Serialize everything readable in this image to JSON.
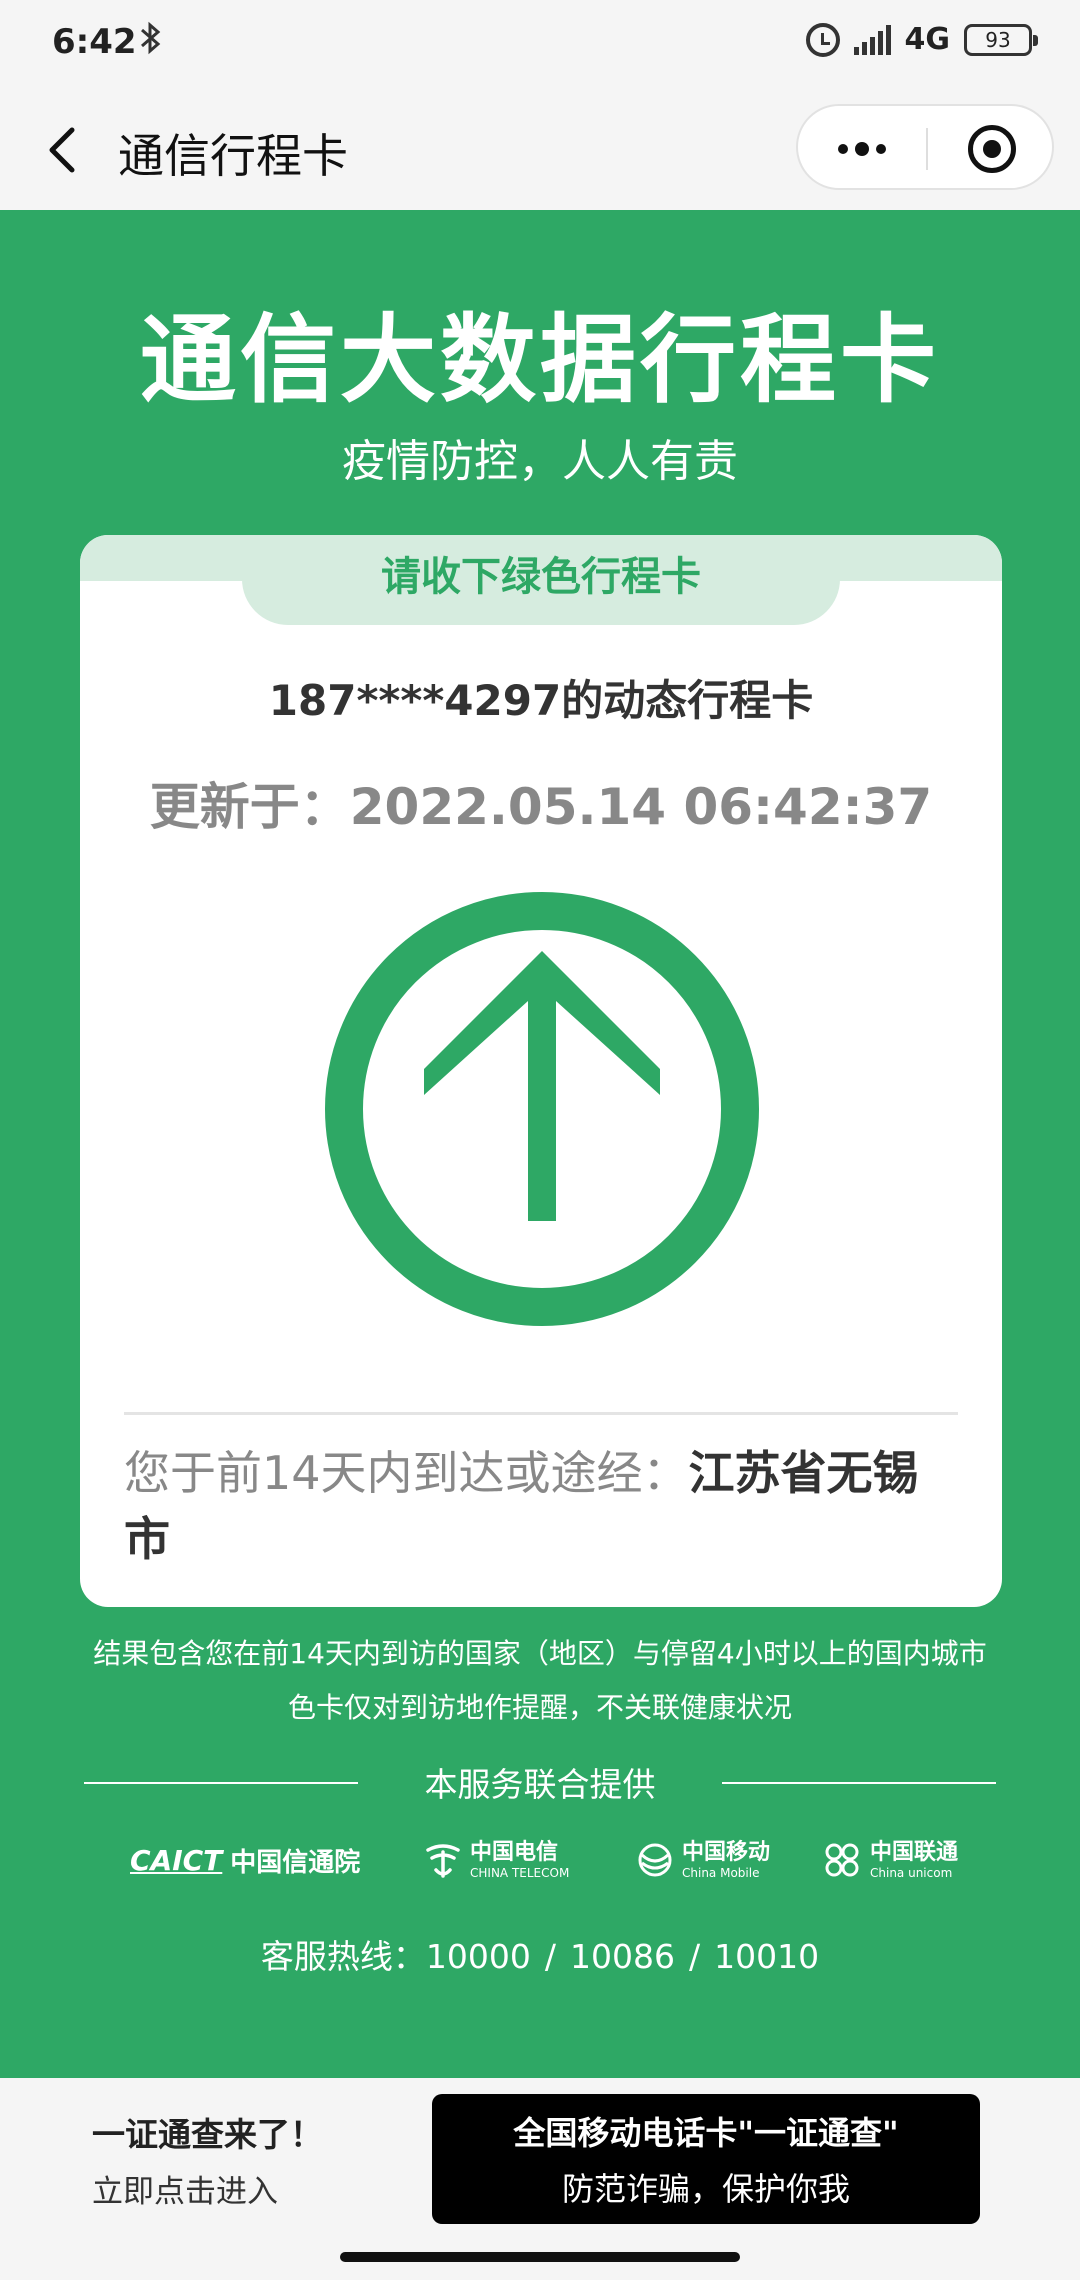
{
  "status_bar": {
    "time": "6:42",
    "network": "4G",
    "battery": "93",
    "icons": [
      "bluetooth-icon",
      "alarm-icon",
      "signal-icon",
      "battery-icon"
    ]
  },
  "nav": {
    "title": "通信行程卡"
  },
  "hero": {
    "title": "通信大数据行程卡",
    "subtitle": "疫情防控，人人有责"
  },
  "card": {
    "tab_label": "请收下绿色行程卡",
    "phone_label": "187****4297的动态行程卡",
    "updated_label": "更新于：2022.05.14 06:42:37",
    "status_color": "#2ea865",
    "visited_prefix": "您于前14天内到达或途经：",
    "visited_place": "江苏省无锡市"
  },
  "notes": {
    "line1": "结果包含您在前14天内到访的国家（地区）与停留4小时以上的国内城市",
    "line2": "色卡仅对到访地作提醒，不关联健康状况"
  },
  "providers": {
    "heading": "本服务联合提供",
    "caict_en": "CAICT",
    "caict_zh": "中国信通院",
    "telecom_zh": "中国电信",
    "telecom_en": "CHINA TELECOM",
    "mobile_zh": "中国移动",
    "mobile_en": "China Mobile",
    "unicom_zh": "中国联通",
    "unicom_en": "China unicom"
  },
  "hotline": {
    "label": "客服热线：",
    "numbers": [
      "10000",
      "10086",
      "10010"
    ],
    "separator": "/"
  },
  "bottom_ad": {
    "left_title": "一证通查来了！",
    "left_sub": "立即点击进入",
    "banner_line1": "全国移动电话卡\"一证通查\"",
    "banner_line2": "防范诈骗，保护你我"
  },
  "colors": {
    "brand_green": "#2ea865",
    "tab_bg": "#d6ecdf"
  }
}
